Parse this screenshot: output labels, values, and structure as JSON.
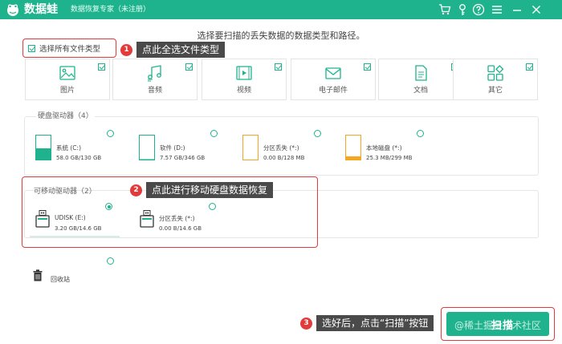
{
  "titlebar": {
    "app_name": "数据蛙",
    "subtitle": "数据恢复专家（未注册）",
    "icons": [
      "cart-icon",
      "key-icon",
      "help-icon",
      "menu-icon",
      "minimize-icon",
      "close-icon"
    ]
  },
  "scan_title": "选择要扫描的丢失数据的数据类型和路径。",
  "select_all": {
    "label": "选择所有文件类型",
    "checked": true
  },
  "file_types": [
    {
      "label": "图片",
      "icon": "image-icon",
      "checked": true
    },
    {
      "label": "音频",
      "icon": "audio-icon",
      "checked": true
    },
    {
      "label": "视频",
      "icon": "video-icon",
      "checked": true
    },
    {
      "label": "电子邮件",
      "icon": "email-icon",
      "checked": true
    },
    {
      "label": "文档",
      "icon": "document-icon",
      "checked": true
    },
    {
      "label": "其它",
      "icon": "other-icon",
      "checked": true
    }
  ],
  "hard_drives": {
    "title": "硬盘驱动器（4）",
    "items": [
      {
        "name": "系统 (C:)",
        "size": "58.0 GB/130 GB",
        "fill": 0.45,
        "color": "#1fb38d"
      },
      {
        "name": "软件 (D:)",
        "size": "7.57 GB/346 GB",
        "fill": 0.02,
        "color": "#1fb38d"
      },
      {
        "name": "分区丢失 (*:)",
        "size": "0.00 B/128 MB",
        "fill": 0,
        "color": "#f5a623"
      },
      {
        "name": "本地磁盘 (*:)",
        "size": "25.3 MB/299 MB",
        "fill": 0.1,
        "color": "#f5a623"
      }
    ]
  },
  "removable_drives": {
    "title": "可移动驱动器（2）",
    "items": [
      {
        "name": "UDISK (E:)",
        "size": "3.20 GB/14.6 GB",
        "selected": true
      },
      {
        "name": "分区丢失 (*:)",
        "size": "0.00 B/14.6 GB",
        "selected": false
      }
    ]
  },
  "recycle_bin": {
    "label": "回收站"
  },
  "callouts": [
    {
      "num": "1",
      "text": "点此全选文件类型"
    },
    {
      "num": "2",
      "text": "点此进行移动硬盘数据恢复"
    },
    {
      "num": "3",
      "text": "选好后，点击“扫描”按钮"
    }
  ],
  "scan_button": {
    "label": "扫描"
  },
  "watermark": "@稀土掘金技术社区",
  "colors": {
    "accent": "#1fb38d",
    "highlight": "#e33a3a",
    "callout_bg": "#4a4a4a"
  }
}
